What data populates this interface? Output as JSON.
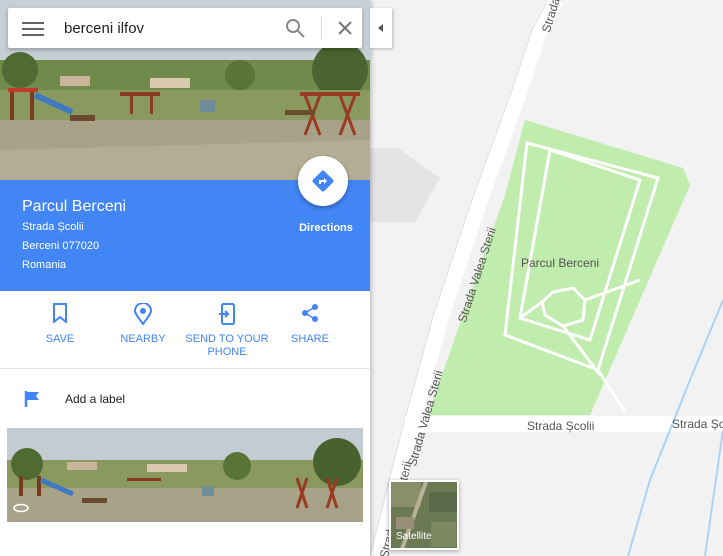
{
  "search": {
    "query": "berceni ilfov"
  },
  "place": {
    "title": "Parcul Berceni",
    "address_lines": [
      "Strada Școlii",
      "Berceni 077020",
      "Romania"
    ]
  },
  "directions": {
    "label": "Directions"
  },
  "actions": [
    {
      "label": "SAVE",
      "icon": "bookmark-icon"
    },
    {
      "label": "NEARBY",
      "icon": "nearby-pin-icon"
    },
    {
      "label": "SEND TO YOUR PHONE",
      "icon": "send-to-phone-icon"
    },
    {
      "label": "SHARE",
      "icon": "share-icon"
    }
  ],
  "add_label": {
    "text": "Add a label",
    "icon": "flag-icon"
  },
  "map": {
    "park_label": "Parcul Berceni",
    "streets": {
      "valea_sterii": "Strada Valea Sterii",
      "scolii": "Strada Școlii",
      "scolii_cut": "Strada Șc"
    }
  },
  "satellite": {
    "label": "Satellite"
  },
  "colors": {
    "accent": "#4285f4",
    "park": "#c0ecae",
    "map_bg": "#f2f2f2"
  }
}
